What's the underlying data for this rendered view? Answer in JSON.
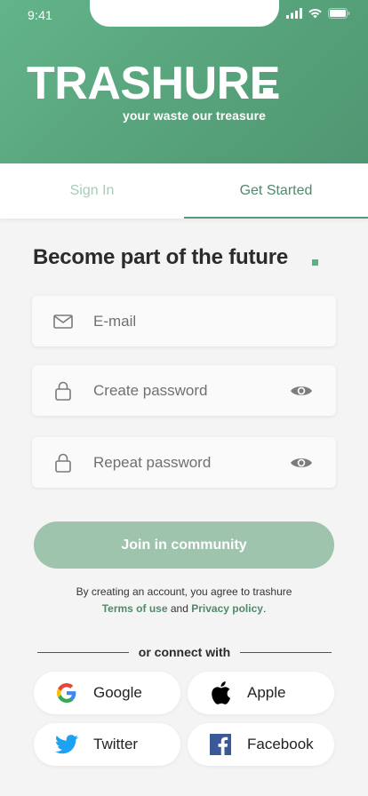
{
  "status_bar": {
    "time": "9:41"
  },
  "header": {
    "brand": "TRASHURE",
    "tagline": "your waste our treasure"
  },
  "tabs": [
    {
      "label": "Sign In",
      "active": false
    },
    {
      "label": "Get Started",
      "active": true
    }
  ],
  "form": {
    "title": "Become part of the future",
    "email_placeholder": "E-mail",
    "password_placeholder": "Create password",
    "repeat_placeholder": "Repeat password",
    "join_label": "Join in community"
  },
  "terms": {
    "line1": "By creating an account, you agree to trashure",
    "terms_link": "Terms of use",
    "and": "and",
    "privacy_link": "Privacy policy",
    "period": "."
  },
  "social": {
    "divider": "or connect with",
    "buttons": [
      {
        "label": "Google",
        "icon": "google-icon"
      },
      {
        "label": "Apple",
        "icon": "apple-icon"
      },
      {
        "label": "Twitter",
        "icon": "twitter-icon"
      },
      {
        "label": "Facebook",
        "icon": "facebook-icon"
      }
    ]
  },
  "colors": {
    "brand_green": "#5aa67e",
    "tab_active": "#4f8a6a",
    "tab_inactive": "#a9cbb8",
    "join_button": "#9fc4ae",
    "twitter": "#1da1f2",
    "facebook": "#3b5998"
  }
}
